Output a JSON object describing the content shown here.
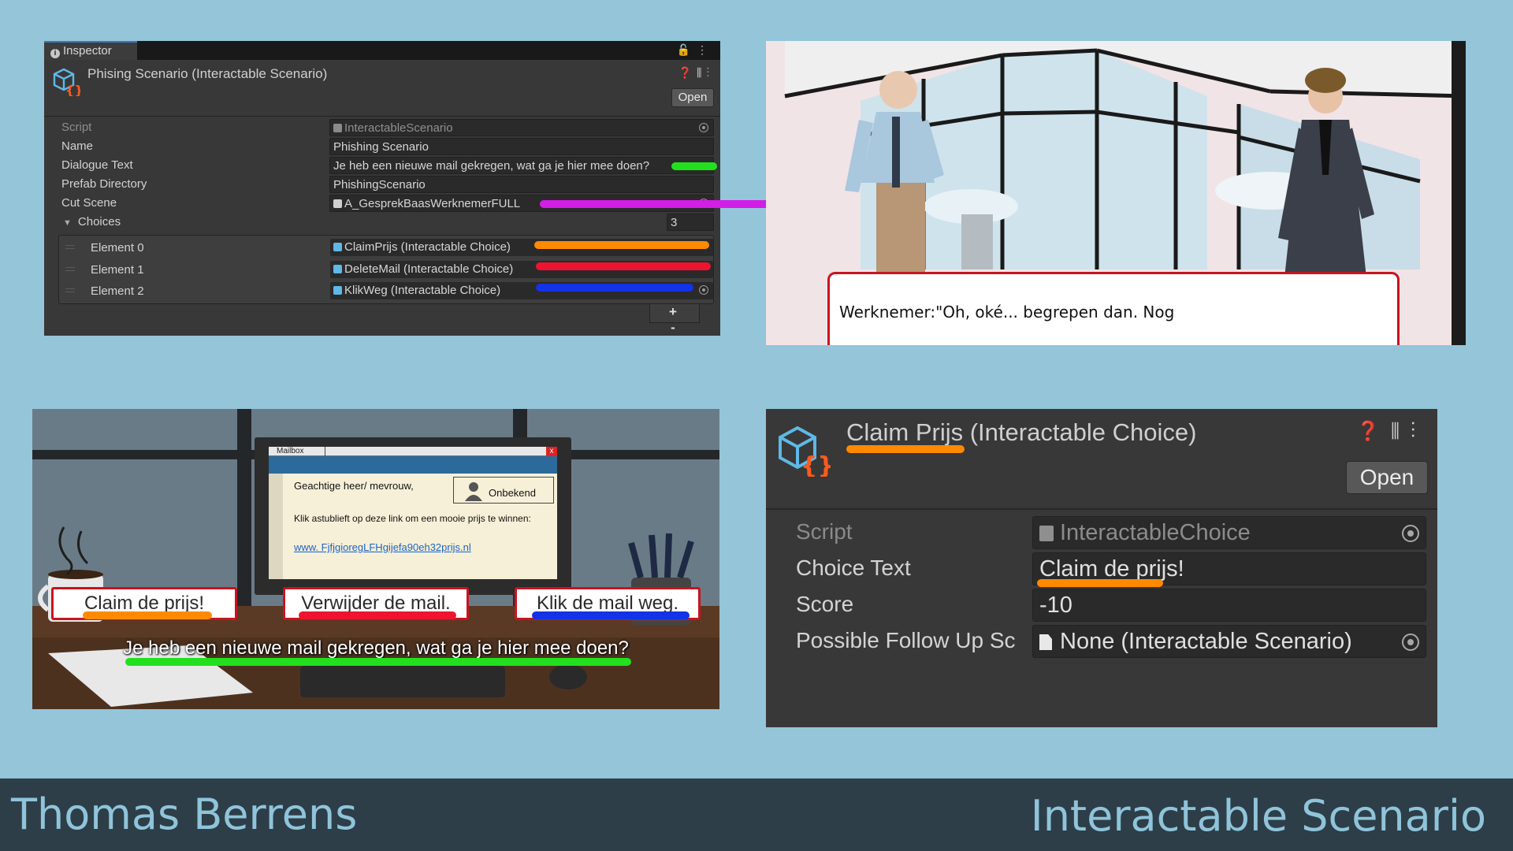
{
  "inspector": {
    "tab_label": "Inspector",
    "object_title": "Phising Scenario (Interactable Scenario)",
    "open_label": "Open",
    "fields": {
      "script_label": "Script",
      "script_value": "InteractableScenario",
      "name_label": "Name",
      "name_value": "Phishing Scenario",
      "dialogue_label": "Dialogue Text",
      "dialogue_value": "Je heb een nieuwe mail gekregen, wat ga je hier mee doen?",
      "prefab_label": "Prefab Directory",
      "prefab_value": "PhishingScenario",
      "cutscene_label": "Cut Scene",
      "cutscene_value": "A_GesprekBaasWerknemerFULL",
      "choices_label": "Choices",
      "choices_count": "3"
    },
    "elements": [
      {
        "label": "Element 0",
        "value": "ClaimPrijs (Interactable Choice)"
      },
      {
        "label": "Element 1",
        "value": "DeleteMail (Interactable Choice)"
      },
      {
        "label": "Element 2",
        "value": "KlikWeg (Interactable Choice)"
      }
    ],
    "add_remove": "+ -"
  },
  "cutscene": {
    "dialog_text": "Werknemer:\"Oh, oké... begrepen dan. Nog"
  },
  "game": {
    "mailbox_tab": "Mailbox",
    "mailbox_close": "x",
    "greeting": "Geachtige heer/ mevrouw,",
    "sender": "Onbekend",
    "body": "Klik astublieft op deze link om een mooie prijs te winnen:",
    "link": "www. FjfjgioregLFHgijefa90eh32prijs.nl",
    "choices": [
      "Claim de prijs!",
      "Verwijder de mail.",
      "Klik de mail weg."
    ],
    "question": "Je heb een nieuwe mail gekregen, wat ga je hier mee doen?"
  },
  "choice_inspector": {
    "title": "Claim Prijs (Interactable Choice)",
    "open_label": "Open",
    "script_label": "Script",
    "script_value": "InteractableChoice",
    "choice_text_label": "Choice Text",
    "choice_text_value": "Claim de prijs!",
    "score_label": "Score",
    "score_value": "-10",
    "followup_label": "Possible Follow Up Sc",
    "followup_value": "None (Interactable Scenario)"
  },
  "footer": {
    "author": "Thomas Berrens",
    "title": "Interactable Scenario"
  },
  "colors": {
    "highlight_green": "#22e01e",
    "highlight_orange": "#ff8a00",
    "highlight_red": "#ee1430",
    "highlight_blue": "#1432e6",
    "arrow_magenta": "#d21ee6",
    "unity_bg": "#383838",
    "page_bg": "#94c5d9"
  }
}
